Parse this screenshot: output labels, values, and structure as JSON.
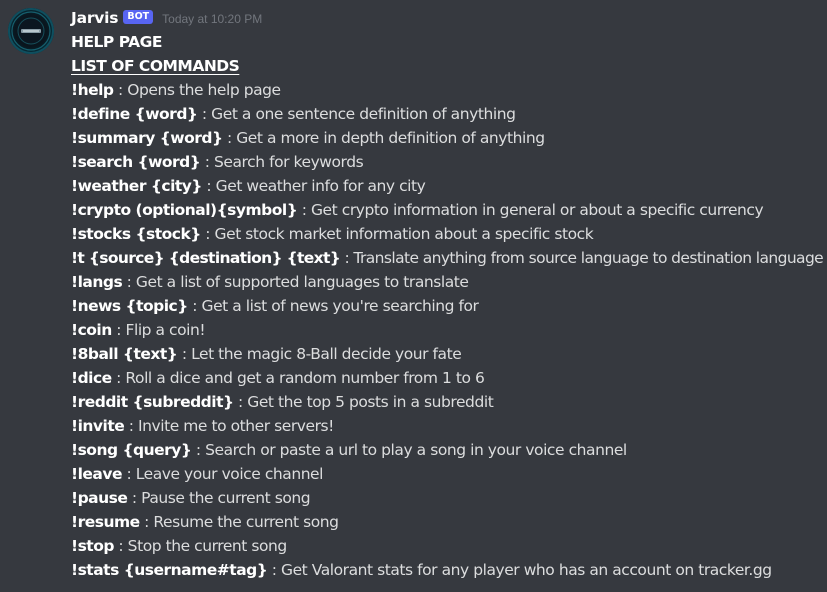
{
  "message": {
    "author": "Jarvis",
    "badge": "BOT",
    "timestamp": "Today at 10:20 PM",
    "avatar_icon": "jarvis-avatar-icon",
    "title": "HELP PAGE",
    "subtitle": "LIST OF COMMANDS",
    "commands": [
      {
        "cmd": "!help",
        "desc": " : Opens the help page"
      },
      {
        "cmd": "!define {word}",
        "desc": " : Get a one sentence definition of anything"
      },
      {
        "cmd": "!summary {word}",
        "desc": " : Get a more in depth definition of anything"
      },
      {
        "cmd": "!search {word}",
        "desc": " : Search for keywords"
      },
      {
        "cmd": "!weather {city}",
        "desc": " : Get weather info for any city"
      },
      {
        "cmd": "!crypto (optional){symbol}",
        "desc": " : Get crypto information in general or about a specific currency"
      },
      {
        "cmd": "!stocks {stock}",
        "desc": " : Get stock market information about a specific stock"
      },
      {
        "cmd": "!t {source} {destination} {text}",
        "desc": " : Translate anything from source language to destination language"
      },
      {
        "cmd": "!langs",
        "desc": " : Get a list of supported languages to translate"
      },
      {
        "cmd": "!news {topic}",
        "desc": " : Get a list of news you're searching for"
      },
      {
        "cmd": "!coin",
        "desc": " : Flip a coin!"
      },
      {
        "cmd": "!8ball {text}",
        "desc": " : Let the magic 8-Ball decide your fate"
      },
      {
        "cmd": "!dice",
        "desc": " : Roll a dice and get a random number from 1 to 6"
      },
      {
        "cmd": "!reddit {subreddit}",
        "desc": " : Get the top 5 posts in a subreddit"
      },
      {
        "cmd": "!invite",
        "desc": " : Invite me to other servers!"
      },
      {
        "cmd": "!song {query}",
        "desc": " : Search or paste a url to play a song in your voice channel"
      },
      {
        "cmd": "!leave",
        "desc": " : Leave your voice channel"
      },
      {
        "cmd": "!pause",
        "desc": " : Pause the current song"
      },
      {
        "cmd": "!resume",
        "desc": " : Resume the current song"
      },
      {
        "cmd": "!stop",
        "desc": " : Stop the current song"
      },
      {
        "cmd": "!stats {username#tag}",
        "desc": " : Get Valorant stats for any player who has an account on tracker.gg"
      }
    ]
  },
  "colors": {
    "background": "#36393f",
    "text": "#dcddde",
    "bold_text": "#ffffff",
    "timestamp": "#72767d",
    "bot_tag": "#5865f2"
  }
}
